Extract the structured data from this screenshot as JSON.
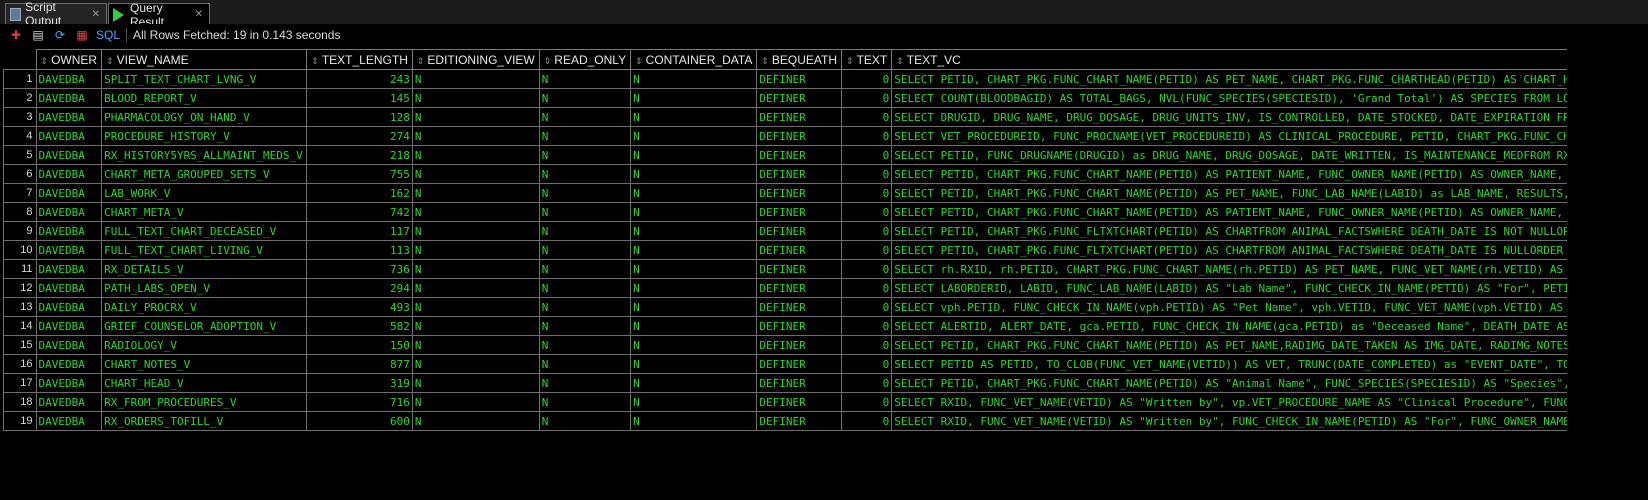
{
  "tabs": [
    {
      "label": "Script Output",
      "icon": "script-icon"
    },
    {
      "label": "Query Result",
      "icon": "play-icon"
    }
  ],
  "toolbar": {
    "sql_label": "SQL",
    "status": "All Rows Fetched: 19 in 0.143 seconds"
  },
  "columns": [
    "OWNER",
    "VIEW_NAME",
    "TEXT_LENGTH",
    "EDITIONING_VIEW",
    "READ_ONLY",
    "CONTAINER_DATA",
    "BEQUEATH",
    "TEXT",
    "TEXT_VC"
  ],
  "rows": [
    {
      "n": "1",
      "owner": "DAVEDBA",
      "view": "SPLIT_TEXT_CHART_LVNG_V",
      "len": "243",
      "ed": "N",
      "ro": "N",
      "cd": "N",
      "bq": "DEFINER",
      "text": "0",
      "vc": "SELECT PETID, CHART_PKG.FUNC_CHART_NAME(PETID) AS PET_NAME, CHART_PKG.FUNC_CHARTHEAD(PETID) AS CHART_HEAD, CHART_"
    },
    {
      "n": "2",
      "owner": "DAVEDBA",
      "view": "BLOOD_REPORT_V",
      "len": "145",
      "ed": "N",
      "ro": "N",
      "cd": "N",
      "bq": "DEFINER",
      "text": "0",
      "vc": "SELECT COUNT(BLOODBAGID) AS TOTAL_BAGS, NVL(FUNC_SPECIES(SPECIESID), 'Grand Total') AS SPECIES FROM LOCAL_BLOOD_B"
    },
    {
      "n": "3",
      "owner": "DAVEDBA",
      "view": "PHARMACOLOGY_ON_HAND_V",
      "len": "128",
      "ed": "N",
      "ro": "N",
      "cd": "N",
      "bq": "DEFINER",
      "text": "0",
      "vc": "SELECT DRUGID, DRUG_NAME,  DRUG_DOSAGE, DRUG_UNITS_INV,  IS_CONTROLLED,  DATE_STOCKED,  DATE_EXPIRATION FROM PHAR"
    },
    {
      "n": "4",
      "owner": "DAVEDBA",
      "view": "PROCEDURE_HISTORY_V",
      "len": "274",
      "ed": "N",
      "ro": "N",
      "cd": "N",
      "bq": "DEFINER",
      "text": "0",
      "vc": "SELECT VET_PROCEDUREID,  FUNC_PROCNAME(VET_PROCEDUREID) AS CLINICAL_PROCEDURE,   PETID,  CHART_PKG.FUNC_CHART_NAM"
    },
    {
      "n": "5",
      "owner": "DAVEDBA",
      "view": "RX_HISTORY5YRS_ALLMAINT_MEDS_V",
      "len": "218",
      "ed": "N",
      "ro": "N",
      "cd": "N",
      "bq": "DEFINER",
      "text": "0",
      "vc": "SELECT PETID, FUNC_DRUGNAME(DRUGID) as DRUG_NAME,  DRUG_DOSAGE, DATE_WRITTEN, IS_MAINTENANCE_MEDFROM RX_HISTORY W"
    },
    {
      "n": "6",
      "owner": "DAVEDBA",
      "view": "CHART_META_GROUPED_SETS_V",
      "len": "755",
      "ed": "N",
      "ro": "N",
      "cd": "N",
      "bq": "DEFINER",
      "text": "0",
      "vc": "SELECT PETID, CHART_PKG.FUNC_CHART_NAME(PETID) AS PATIENT_NAME, FUNC_OWNER_NAME(PETID) AS OWNER_NAME, FUNC_ALL_SI"
    },
    {
      "n": "7",
      "owner": "DAVEDBA",
      "view": "LAB_WORK_V",
      "len": "162",
      "ed": "N",
      "ro": "N",
      "cd": "N",
      "bq": "DEFINER",
      "text": "0",
      "vc": "SELECT    PETID,  CHART_PKG.FUNC_CHART_NAME(PETID) AS PET_NAME, FUNC_LAB_NAME(LABID) as LAB_NAME, RESULTS, DATE_CO"
    },
    {
      "n": "8",
      "owner": "DAVEDBA",
      "view": "CHART_META_V",
      "len": "742",
      "ed": "N",
      "ro": "N",
      "cd": "N",
      "bq": "DEFINER",
      "text": "0",
      "vc": "SELECT PETID, CHART_PKG.FUNC_CHART_NAME(PETID) AS PATIENT_NAME, FUNC_OWNER_NAME(PETID) AS OWNER_NAME, FUNC_ALL_SI"
    },
    {
      "n": "9",
      "owner": "DAVEDBA",
      "view": "FULL_TEXT_CHART_DECEASED_V",
      "len": "117",
      "ed": "N",
      "ro": "N",
      "cd": "N",
      "bq": "DEFINER",
      "text": "0",
      "vc": "SELECT PETID, CHART_PKG.FUNC_FLTXTCHART(PETID) AS CHARTFROM ANIMAL_FACTSWHERE DEATH_DATE IS NOT NULLORDER BY PETI"
    },
    {
      "n": "10",
      "owner": "DAVEDBA",
      "view": "FULL_TEXT_CHART_LIVING_V",
      "len": "113",
      "ed": "N",
      "ro": "N",
      "cd": "N",
      "bq": "DEFINER",
      "text": "0",
      "vc": "SELECT PETID, CHART_PKG.FUNC_FLTXTCHART(PETID) AS CHARTFROM ANIMAL_FACTSWHERE DEATH_DATE IS NULLORDER BY PETID"
    },
    {
      "n": "11",
      "owner": "DAVEDBA",
      "view": "RX_DETAILS_V",
      "len": "736",
      "ed": "N",
      "ro": "N",
      "cd": "N",
      "bq": "DEFINER",
      "text": "0",
      "vc": "SELECT rh.RXID, rh.PETID, CHART_PKG.FUNC_CHART_NAME(rh.PETID) AS PET_NAME, FUNC_VET_NAME(rh.VETID) AS VET_NAME,"
    },
    {
      "n": "12",
      "owner": "DAVEDBA",
      "view": "PATH_LABS_OPEN_V",
      "len": "294",
      "ed": "N",
      "ro": "N",
      "cd": "N",
      "bq": "DEFINER",
      "text": "0",
      "vc": "SELECT LABORDERID, LABID, FUNC_LAB_NAME(LABID) AS \"Lab Name\", FUNC_CHECK_IN_NAME(PETID) AS \"For\", PETID AS \"Patie"
    },
    {
      "n": "13",
      "owner": "DAVEDBA",
      "view": "DAILY_PROCRX_V",
      "len": "493",
      "ed": "N",
      "ro": "N",
      "cd": "N",
      "bq": "DEFINER",
      "text": "0",
      "vc": "SELECT vph.PETID, FUNC_CHECK_IN_NAME(vph.PETID) AS \"Pet Name\", vph.VETID,  FUNC_VET_NAME(vph.VETID) AS \"Veterinar"
    },
    {
      "n": "14",
      "owner": "DAVEDBA",
      "view": "GRIEF_COUNSELOR_ADOPTION_V",
      "len": "582",
      "ed": "N",
      "ro": "N",
      "cd": "N",
      "bq": "DEFINER",
      "text": "0",
      "vc": "SELECT ALERTID, ALERT_DATE, gca.PETID, FUNC_CHECK_IN_NAME(gca.PETID) as \"Deceased Name\", DEATH_DATE AS \"Date of P"
    },
    {
      "n": "15",
      "owner": "DAVEDBA",
      "view": "RADIOLOGY_V",
      "len": "150",
      "ed": "N",
      "ro": "N",
      "cd": "N",
      "bq": "DEFINER",
      "text": "0",
      "vc": "SELECT PETID, CHART_PKG.FUNC_CHART_NAME(PETID) AS PET_NAME,RADIMG_DATE_TAKEN AS IMG_DATE, RADIMG_NOTES, RADIMG_FI"
    },
    {
      "n": "16",
      "owner": "DAVEDBA",
      "view": "CHART_NOTES_V",
      "len": "877",
      "ed": "N",
      "ro": "N",
      "cd": "N",
      "bq": "DEFINER",
      "text": "0",
      "vc": "SELECT PETID AS PETID, TO_CLOB(FUNC_VET_NAME(VETID)) AS VET, TRUNC(DATE_COMPLETED) as \"EVENT_DATE\", TO_CLOB(FUNC_"
    },
    {
      "n": "17",
      "owner": "DAVEDBA",
      "view": "CHART_HEAD_V",
      "len": "319",
      "ed": "N",
      "ro": "N",
      "cd": "N",
      "bq": "DEFINER",
      "text": "0",
      "vc": "SELECT PETID, CHART_PKG.FUNC_CHART_NAME(PETID) AS \"Animal Name\", FUNC_SPECIES(SPECIESID) AS \"Species\", FUNC_BREED"
    },
    {
      "n": "18",
      "owner": "DAVEDBA",
      "view": "RX_FROM_PROCEDURES_V",
      "len": "716",
      "ed": "N",
      "ro": "N",
      "cd": "N",
      "bq": "DEFINER",
      "text": "0",
      "vc": "SELECT  RXID, FUNC_VET_NAME(VETID) AS \"Written by\", vp.VET_PROCEDURE_NAME AS \"Clinical Procedure\", FUNC_CHECK_IN_"
    },
    {
      "n": "19",
      "owner": "DAVEDBA",
      "view": "RX_ORDERS_TOFILL_V",
      "len": "600",
      "ed": "N",
      "ro": "N",
      "cd": "N",
      "bq": "DEFINER",
      "text": "0",
      "vc": "SELECT  RXID, FUNC_VET_NAME(VETID) AS \"Written by\", FUNC_CHECK_IN_NAME(PETID) AS \"For\", FUNC_OWNER_NAME(petid) AS"
    }
  ]
}
